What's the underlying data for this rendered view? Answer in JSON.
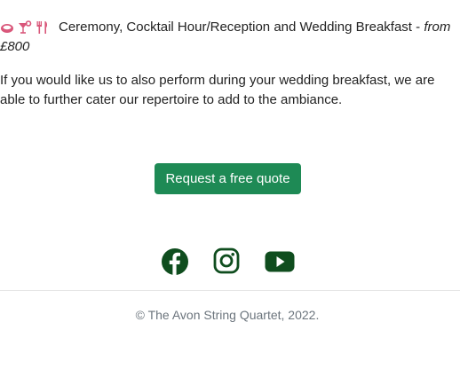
{
  "package": {
    "icons": [
      "ring-icon",
      "cocktail-icon",
      "cutlery-icon"
    ],
    "title": "Ceremony, Cocktail Hour/Reception and Wedding Breakfast - ",
    "price": "from £800"
  },
  "paragraph": "If you would like us to also perform during your wedding breakfast, we are able to further cater our repertoire to add to the ambiance.",
  "cta": {
    "label": "Request a free quote",
    "color": "#1e8a55"
  },
  "social": [
    {
      "name": "facebook-icon"
    },
    {
      "name": "instagram-icon"
    },
    {
      "name": "youtube-icon"
    }
  ],
  "icon_colors": {
    "package": "#d9577a",
    "social": "#0f4d1e"
  },
  "footer": "© The Avon String Quartet, 2022."
}
